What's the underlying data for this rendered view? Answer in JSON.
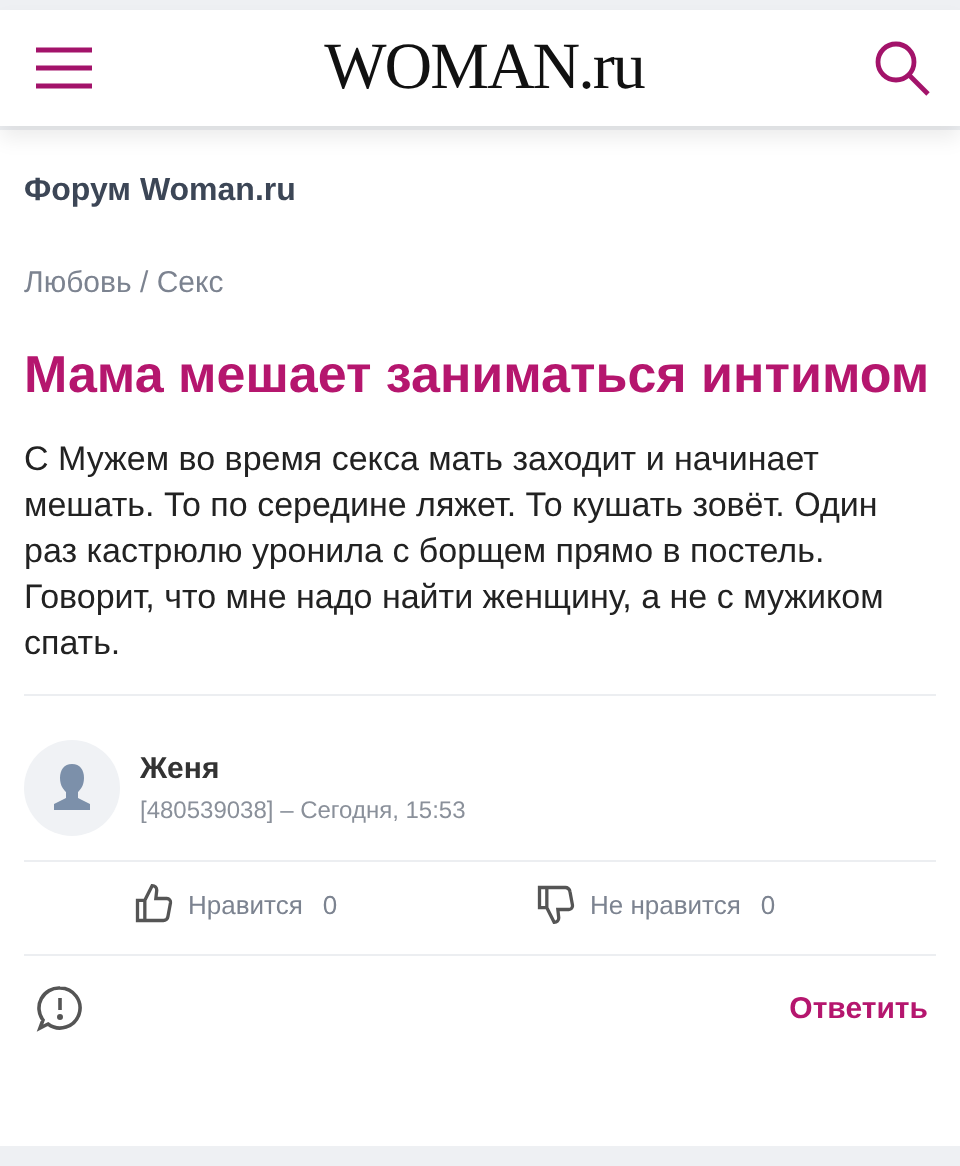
{
  "header": {
    "logo": "WOMAN.ru"
  },
  "forum_title": "Форум Woman.ru",
  "breadcrumbs": "Любовь / Секс",
  "topic": {
    "title": "Мама мешает заниматься интимом",
    "body": "С Мужем во время секса мать заходит и начинает мешать. То по середине ляжет. То кушать зовёт. Один раз кастрюлю уронила с борщем прямо в постель. Говорит, что мне надо найти женщину, а не с мужиком спать."
  },
  "author": {
    "name": "Женя",
    "meta": "[480539038] – Сегодня, 15:53"
  },
  "reactions": [
    {
      "kind": "like",
      "label": "Нравится",
      "count": "0"
    },
    {
      "kind": "dislike",
      "label": "Не нравится",
      "count": "0"
    }
  ],
  "reply_button": "Ответить"
}
